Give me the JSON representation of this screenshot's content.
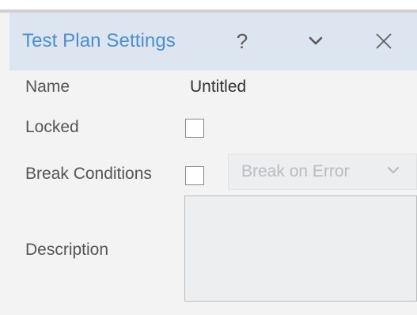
{
  "header": {
    "title": "Test Plan Settings",
    "help_label": "?",
    "icons": {
      "chevron": "chevron-down-icon",
      "close": "close-icon"
    }
  },
  "form": {
    "name": {
      "label": "Name",
      "value": "Untitled"
    },
    "locked": {
      "label": "Locked",
      "checked": false
    },
    "break_conditions": {
      "label": "Break Conditions",
      "checked": false,
      "select_value": "Break on Error"
    },
    "description": {
      "label": "Description",
      "value": ""
    }
  },
  "colors": {
    "title_accent": "#4a8fd6",
    "header_bg": "#dce5f0",
    "panel_bg": "#f3f3f3"
  }
}
